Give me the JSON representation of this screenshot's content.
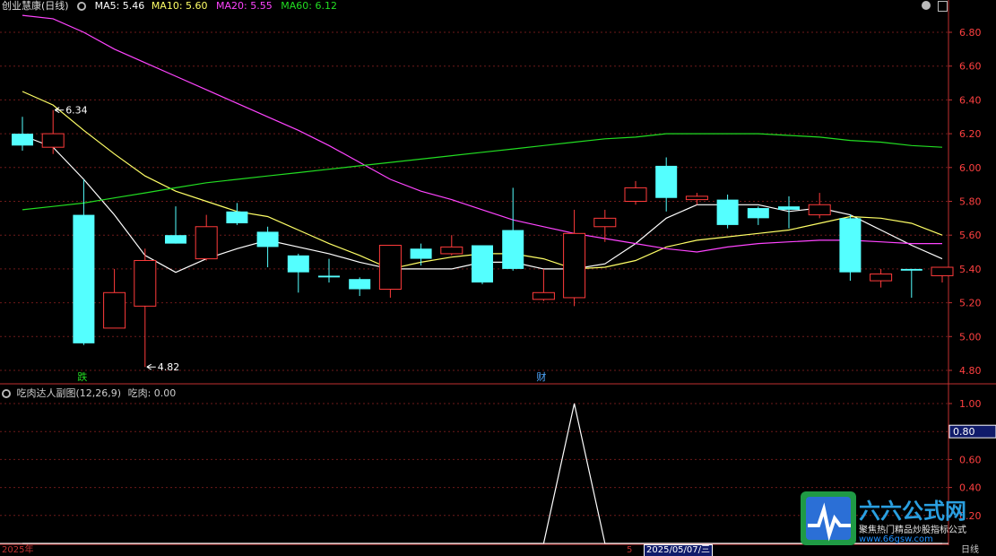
{
  "header": {
    "stock_title": "创业慧康(日线)",
    "ma5": "MA5: 5.46",
    "ma10": "MA10: 5.60",
    "ma20": "MA20: 5.55",
    "ma60": "MA60: 6.12"
  },
  "sub_header": {
    "title": "吃肉达人副图(12,26,9)",
    "value": "吃肉: 0.00"
  },
  "colors": {
    "up": "#ff3b3b",
    "down": "#54ffff",
    "ma5": "#ffffff",
    "ma10": "#ffff66",
    "ma20": "#ff44ff",
    "ma60": "#22dd22",
    "axis": "#c03030",
    "grid": "#6e1a1a",
    "ma60_label": "#22dd22"
  },
  "annotations": {
    "high_label": "6.34",
    "low_label": "4.82",
    "signal_die": "跌",
    "signal_cai": "财"
  },
  "right_axis": {
    "main_ticks": [
      "6.80",
      "6.60",
      "6.40",
      "6.20",
      "6.00",
      "5.80",
      "5.60",
      "5.40",
      "5.20",
      "5.00",
      "4.80"
    ],
    "sub_ticks": [
      "1.00",
      "0.80",
      "0.60",
      "0.40",
      "0.20"
    ],
    "sub_highlight": "0.80"
  },
  "bottom": {
    "year": "2025年",
    "mid_label": "5",
    "date_label": "2025/05/07/三",
    "period": "日线"
  },
  "logo": {
    "name": "六六公式网",
    "slogan": "聚焦热门精品炒股指标公式",
    "url": "www.66gsw.com"
  },
  "chart_data": [
    {
      "type": "candlestick",
      "title": "创业慧康(日线)",
      "ylim": [
        4.8,
        6.9
      ],
      "candles": [
        {
          "o": 6.2,
          "h": 6.3,
          "l": 6.1,
          "c": 6.13
        },
        {
          "o": 6.12,
          "h": 6.34,
          "l": 6.08,
          "c": 6.2
        },
        {
          "o": 5.72,
          "h": 5.93,
          "l": 4.95,
          "c": 4.96
        },
        {
          "o": 5.05,
          "h": 5.4,
          "l": 5.05,
          "c": 5.26
        },
        {
          "o": 5.18,
          "h": 5.52,
          "l": 4.82,
          "c": 5.45
        },
        {
          "o": 5.6,
          "h": 5.77,
          "l": 5.55,
          "c": 5.55
        },
        {
          "o": 5.46,
          "h": 5.72,
          "l": 5.45,
          "c": 5.65
        },
        {
          "o": 5.74,
          "h": 5.79,
          "l": 5.66,
          "c": 5.67
        },
        {
          "o": 5.62,
          "h": 5.65,
          "l": 5.41,
          "c": 5.53
        },
        {
          "o": 5.48,
          "h": 5.49,
          "l": 5.26,
          "c": 5.38
        },
        {
          "o": 5.36,
          "h": 5.46,
          "l": 5.32,
          "c": 5.35
        },
        {
          "o": 5.34,
          "h": 5.35,
          "l": 5.24,
          "c": 5.28
        },
        {
          "o": 5.28,
          "h": 5.54,
          "l": 5.23,
          "c": 5.54
        },
        {
          "o": 5.52,
          "h": 5.55,
          "l": 5.42,
          "c": 5.46
        },
        {
          "o": 5.49,
          "h": 5.6,
          "l": 5.48,
          "c": 5.53
        },
        {
          "o": 5.54,
          "h": 5.54,
          "l": 5.31,
          "c": 5.32
        },
        {
          "o": 5.63,
          "h": 5.88,
          "l": 5.39,
          "c": 5.4
        },
        {
          "o": 5.22,
          "h": 5.4,
          "l": 5.21,
          "c": 5.26
        },
        {
          "o": 5.23,
          "h": 5.75,
          "l": 5.18,
          "c": 5.61
        },
        {
          "o": 5.65,
          "h": 5.75,
          "l": 5.56,
          "c": 5.7
        },
        {
          "o": 5.8,
          "h": 5.92,
          "l": 5.78,
          "c": 5.88
        },
        {
          "o": 6.01,
          "h": 6.06,
          "l": 5.74,
          "c": 5.82
        },
        {
          "o": 5.81,
          "h": 5.85,
          "l": 5.78,
          "c": 5.83
        },
        {
          "o": 5.81,
          "h": 5.84,
          "l": 5.64,
          "c": 5.66
        },
        {
          "o": 5.76,
          "h": 5.77,
          "l": 5.66,
          "c": 5.7
        },
        {
          "o": 5.77,
          "h": 5.83,
          "l": 5.64,
          "c": 5.75
        },
        {
          "o": 5.72,
          "h": 5.85,
          "l": 5.7,
          "c": 5.78
        },
        {
          "o": 5.7,
          "h": 5.72,
          "l": 5.33,
          "c": 5.38
        },
        {
          "o": 5.33,
          "h": 5.4,
          "l": 5.29,
          "c": 5.37
        },
        {
          "o": 5.4,
          "h": 5.4,
          "l": 5.23,
          "c": 5.39
        },
        {
          "o": 5.36,
          "h": 5.4,
          "l": 5.32,
          "c": 5.41
        }
      ],
      "series": [
        {
          "name": "MA5",
          "values": [
            6.19,
            6.12,
            5.93,
            5.72,
            5.48,
            5.38,
            5.46,
            5.52,
            5.57,
            5.53,
            5.49,
            5.44,
            5.4,
            5.4,
            5.4,
            5.44,
            5.44,
            5.4,
            5.4,
            5.43,
            5.55,
            5.7,
            5.78,
            5.78,
            5.78,
            5.74,
            5.76,
            5.72,
            5.63,
            5.54,
            5.46
          ]
        },
        {
          "name": "MA10",
          "values": [
            6.45,
            6.37,
            6.22,
            6.08,
            5.95,
            5.86,
            5.8,
            5.74,
            5.71,
            5.63,
            5.55,
            5.48,
            5.4,
            5.44,
            5.47,
            5.49,
            5.49,
            5.46,
            5.4,
            5.41,
            5.45,
            5.53,
            5.57,
            5.59,
            5.61,
            5.63,
            5.67,
            5.71,
            5.7,
            5.67,
            5.6
          ]
        },
        {
          "name": "MA20",
          "values": [
            6.9,
            6.88,
            6.8,
            6.7,
            6.62,
            6.54,
            6.46,
            6.38,
            6.3,
            6.22,
            6.13,
            6.03,
            5.93,
            5.86,
            5.81,
            5.75,
            5.69,
            5.65,
            5.61,
            5.58,
            5.55,
            5.52,
            5.5,
            5.53,
            5.55,
            5.56,
            5.57,
            5.57,
            5.56,
            5.55,
            5.55
          ]
        },
        {
          "name": "MA60",
          "values": [
            5.75,
            5.77,
            5.79,
            5.82,
            5.85,
            5.88,
            5.91,
            5.93,
            5.95,
            5.97,
            5.99,
            6.01,
            6.03,
            6.05,
            6.07,
            6.09,
            6.11,
            6.13,
            6.15,
            6.17,
            6.18,
            6.2,
            6.2,
            6.2,
            6.2,
            6.19,
            6.18,
            6.16,
            6.15,
            6.13,
            6.12
          ]
        }
      ]
    },
    {
      "type": "line",
      "title": "吃肉达人副图(12,26,9)",
      "ylim": [
        0,
        1.1
      ],
      "series": [
        {
          "name": "吃肉",
          "values": [
            0,
            0,
            0,
            0,
            0,
            0,
            0,
            0,
            0,
            0,
            0,
            0,
            0,
            0,
            0,
            0,
            0,
            0,
            1,
            0,
            0,
            0,
            0,
            0,
            0,
            0,
            0,
            0,
            0,
            0,
            0
          ]
        }
      ]
    }
  ]
}
